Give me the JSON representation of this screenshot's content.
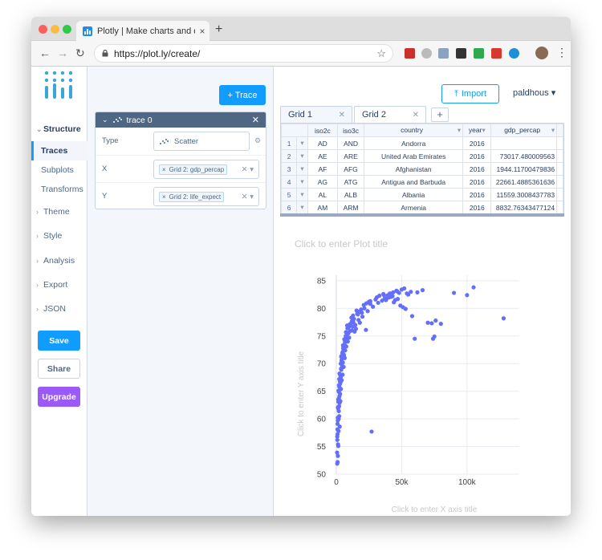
{
  "browser": {
    "tab_title": "Plotly | Make charts and dashb",
    "tab_close": "×",
    "new_tab": "+",
    "url": "https://plot.ly/create/",
    "back": "←",
    "forward": "→",
    "reload": "↻",
    "menu": "⋮",
    "star": "☆",
    "colors": {
      "close": "#fc605c",
      "minimize": "#fdbc40",
      "maximize": "#34c84a"
    }
  },
  "sidebar": {
    "structure_label": "Structure",
    "subitems": [
      "Traces",
      "Subplots",
      "Transforms"
    ],
    "sections": [
      "Theme",
      "Style",
      "Analysis",
      "Export",
      "JSON"
    ],
    "save_label": "Save",
    "share_label": "Share",
    "upgrade_label": "Upgrade"
  },
  "panel": {
    "add_trace_label": "+ Trace",
    "trace_title": "trace 0",
    "type_label": "Type",
    "type_value": "Scatter",
    "x_label": "X",
    "x_value": "Grid 2: gdp_percap",
    "y_label": "Y",
    "y_value": "Grid 2: life_expect"
  },
  "main": {
    "import_label": "Import",
    "user_label": "paldhous",
    "grid_tabs": [
      "Grid 1",
      "Grid 2"
    ],
    "grid_add": "+",
    "columns": [
      "iso2c",
      "iso3c",
      "country",
      "year",
      "gdp_percap"
    ],
    "rows": [
      [
        "1",
        "AD",
        "AND",
        "Andorra",
        "2016",
        ""
      ],
      [
        "2",
        "AE",
        "ARE",
        "United Arab Emirates",
        "2016",
        "73017.480009563"
      ],
      [
        "3",
        "AF",
        "AFG",
        "Afghanistan",
        "2016",
        "1944.11700479836"
      ],
      [
        "4",
        "AG",
        "ATG",
        "Antigua and Barbuda",
        "2016",
        "22661.4885361636"
      ],
      [
        "5",
        "AL",
        "ALB",
        "Albania",
        "2016",
        "11559.3008437783"
      ],
      [
        "6",
        "AM",
        "ARM",
        "Armenia",
        "2016",
        "8832.76343477124"
      ]
    ]
  },
  "chart_data": {
    "type": "scatter",
    "title": "Click to enter Plot title",
    "xlabel": "Click to enter X axis title",
    "ylabel": "Click to enter Y axis title",
    "xlim": [
      0,
      140000
    ],
    "ylim": [
      50,
      86
    ],
    "x_ticks": [
      0,
      50000,
      100000
    ],
    "x_tick_labels": [
      "0",
      "50k",
      "100k"
    ],
    "y_ticks": [
      50,
      55,
      60,
      65,
      70,
      75,
      80,
      85
    ],
    "grid": true,
    "color": "#636efa",
    "x": [
      73000,
      1944,
      22661,
      11559,
      8832,
      1200,
      1500,
      2200,
      2600,
      3100,
      3500,
      4200,
      4800,
      5400,
      6000,
      6600,
      7200,
      7900,
      8500,
      9200,
      10000,
      11000,
      12000,
      13000,
      14000,
      15000,
      16500,
      18000,
      19500,
      21000,
      23000,
      25000,
      27000,
      30000,
      33000,
      36000,
      39000,
      42000,
      45000,
      48000,
      51000,
      55000,
      58000,
      62000,
      66000,
      70000,
      75000,
      80000,
      90000,
      100000,
      105000,
      128000,
      1000,
      1300,
      1700,
      1900,
      2100,
      2400,
      2800,
      3300,
      3800,
      4400,
      5000,
      5800,
      6800,
      7600,
      8800,
      9800,
      10500,
      12500,
      14500,
      17000,
      20000,
      24000,
      28000,
      32000,
      37000,
      41000,
      46000,
      52000,
      600,
      800,
      950,
      1100,
      1400,
      1600,
      2000,
      2300,
      2700,
      3000,
      3600,
      4000,
      4600,
      5200,
      6300,
      7000,
      8100,
      9500,
      11800,
      13500,
      16000,
      19000,
      26000,
      35000,
      43000,
      47000,
      39500,
      44000,
      49000,
      53000,
      60000,
      74000,
      2500,
      3200,
      900,
      1150,
      700,
      1800,
      2900,
      4100,
      5600,
      6400,
      700,
      900,
      1250,
      1500,
      1700,
      2050,
      2250,
      2450,
      3400,
      3700,
      4900,
      5100,
      6100,
      7400,
      8300,
      10200,
      12800,
      15500,
      17500,
      21500,
      26000,
      31000,
      36500,
      38000,
      40500,
      43500,
      46500,
      50000,
      54000,
      57000,
      76000
    ],
    "y": [
      77.3,
      63.7,
      76.1,
      78.3,
      74.6,
      53.3,
      55.1,
      60.5,
      58.6,
      63.2,
      65.4,
      70.8,
      68.0,
      72.3,
      71.2,
      73.9,
      75.0,
      74.1,
      76.4,
      75.5,
      76.8,
      77.2,
      76.0,
      77.5,
      75.8,
      76.3,
      78.9,
      77.4,
      79.2,
      80.6,
      80.9,
      81.2,
      57.7,
      81.6,
      82.3,
      82.6,
      81.9,
      82.1,
      81.5,
      82.8,
      80.2,
      82.5,
      78.6,
      82.9,
      83.3,
      77.4,
      74.9,
      77.2,
      82.8,
      82.4,
      83.8,
      78.2,
      52.2,
      55.4,
      57.8,
      61.4,
      62.3,
      64.1,
      66.3,
      67.5,
      68.9,
      69.7,
      70.2,
      71.6,
      72.4,
      73.1,
      74.0,
      74.7,
      75.9,
      76.7,
      77.0,
      77.9,
      78.5,
      79.5,
      80.3,
      81.0,
      81.8,
      82.7,
      83.2,
      83.6,
      53.9,
      56.2,
      59.1,
      60.2,
      61.9,
      63.1,
      64.9,
      65.8,
      66.8,
      67.9,
      69.1,
      70.5,
      71.9,
      72.8,
      73.5,
      74.3,
      75.2,
      76.6,
      77.6,
      78.1,
      79.0,
      79.8,
      80.8,
      81.4,
      82.2,
      81.7,
      82.4,
      81.1,
      80.5,
      79.9,
      74.5,
      74.5,
      62.9,
      66.6,
      58.1,
      59.7,
      51.9,
      60.0,
      64.5,
      67.0,
      69.4,
      71.0,
      56.8,
      57.2,
      62.1,
      63.5,
      65.1,
      66.1,
      67.2,
      68.2,
      70.0,
      71.3,
      72.1,
      73.3,
      74.4,
      75.7,
      76.9,
      77.1,
      78.7,
      79.6,
      79.4,
      80.0,
      81.3,
      82.0,
      82.4,
      81.5,
      82.0,
      82.9,
      83.1,
      83.4,
      82.7,
      83.0,
      77.8
    ]
  }
}
